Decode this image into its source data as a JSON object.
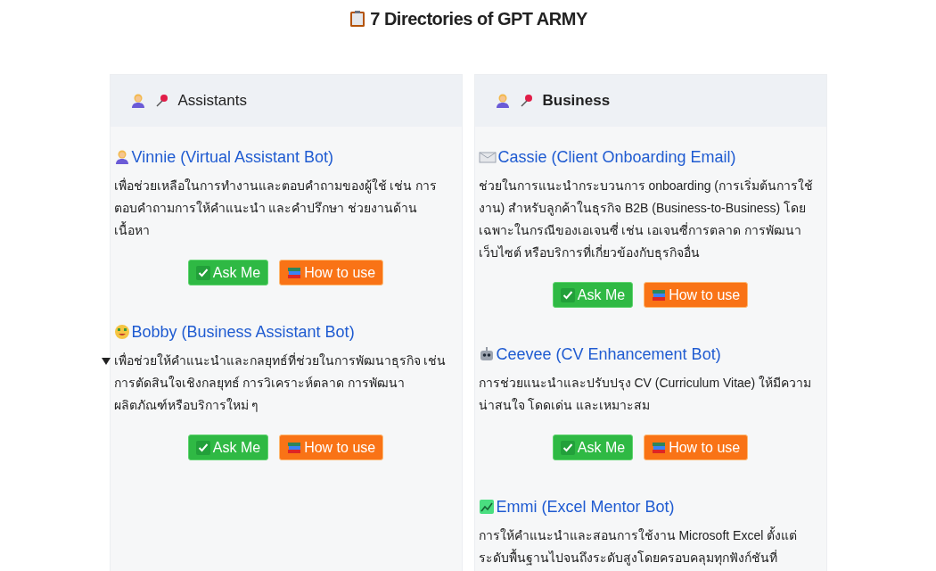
{
  "title": "7 Directories of GPT ARMY",
  "columns": [
    {
      "heading": "Assistants",
      "bold": false,
      "bots": [
        {
          "name": "Vinnie (Virtual Assistant Bot)",
          "disclosure": false,
          "description": "เพื่อช่วยเหลือในการทำงานและตอบคำถามของผู้ใช้ เช่น การตอบคำถามการให้คำแนะนำ และคำปรึกษา ช่วยงานด้านเนื้อหา",
          "buttons": [
            {
              "kind": "ask",
              "label": "Ask Me"
            },
            {
              "kind": "howto",
              "label": "How to use"
            }
          ]
        },
        {
          "name": "Bobby (Business Assistant Bot)",
          "disclosure": true,
          "description": "เพื่อช่วยให้คำแนะนำและกลยุทธ์ที่ช่วยในการพัฒนาธุรกิจ เช่น การตัดสินใจเชิงกลยุทธ์ การวิเคราะห์ตลาด การพัฒนาผลิตภัณฑ์หรือบริการใหม่ ๆ",
          "buttons": [
            {
              "kind": "ask",
              "label": "Ask Me"
            },
            {
              "kind": "howto",
              "label": "How to use"
            }
          ]
        }
      ]
    },
    {
      "heading": "Business",
      "bold": true,
      "bots": [
        {
          "name": "Cassie (Client Onboarding Email)",
          "disclosure": false,
          "description": "ช่วยในการแนะนำกระบวนการ onboarding (การเริ่มต้นการใช้งาน) สำหรับลูกค้าในธุรกิจ B2B (Business-to-Business) โดยเฉพาะในกรณีของเอเจนซี่ เช่น เอเจนซี่การตลาด การพัฒนาเว็บไซต์ หรือบริการที่เกี่ยวข้องกับธุรกิจอื่น",
          "buttons": [
            {
              "kind": "ask",
              "label": "Ask Me"
            },
            {
              "kind": "howto",
              "label": "How to use"
            }
          ]
        },
        {
          "name": "Ceevee (CV Enhancement Bot)",
          "disclosure": false,
          "description": "การช่วยแนะนำและปรับปรุง CV (Curriculum Vitae) ให้มีความน่าสนใจ โดดเด่น และเหมาะสม",
          "buttons": [
            {
              "kind": "ask",
              "label": "Ask Me"
            },
            {
              "kind": "howto",
              "label": "How to use"
            }
          ]
        },
        {
          "name": "Emmi (Excel Mentor Bot)",
          "disclosure": false,
          "description": "การให้คำแนะนำและสอนการใช้งาน Microsoft Excel ตั้งแต่ระดับพื้นฐานไปจนถึงระดับสูงโดยครอบคลุมทุกฟังก์ชันที่"
        }
      ]
    }
  ]
}
